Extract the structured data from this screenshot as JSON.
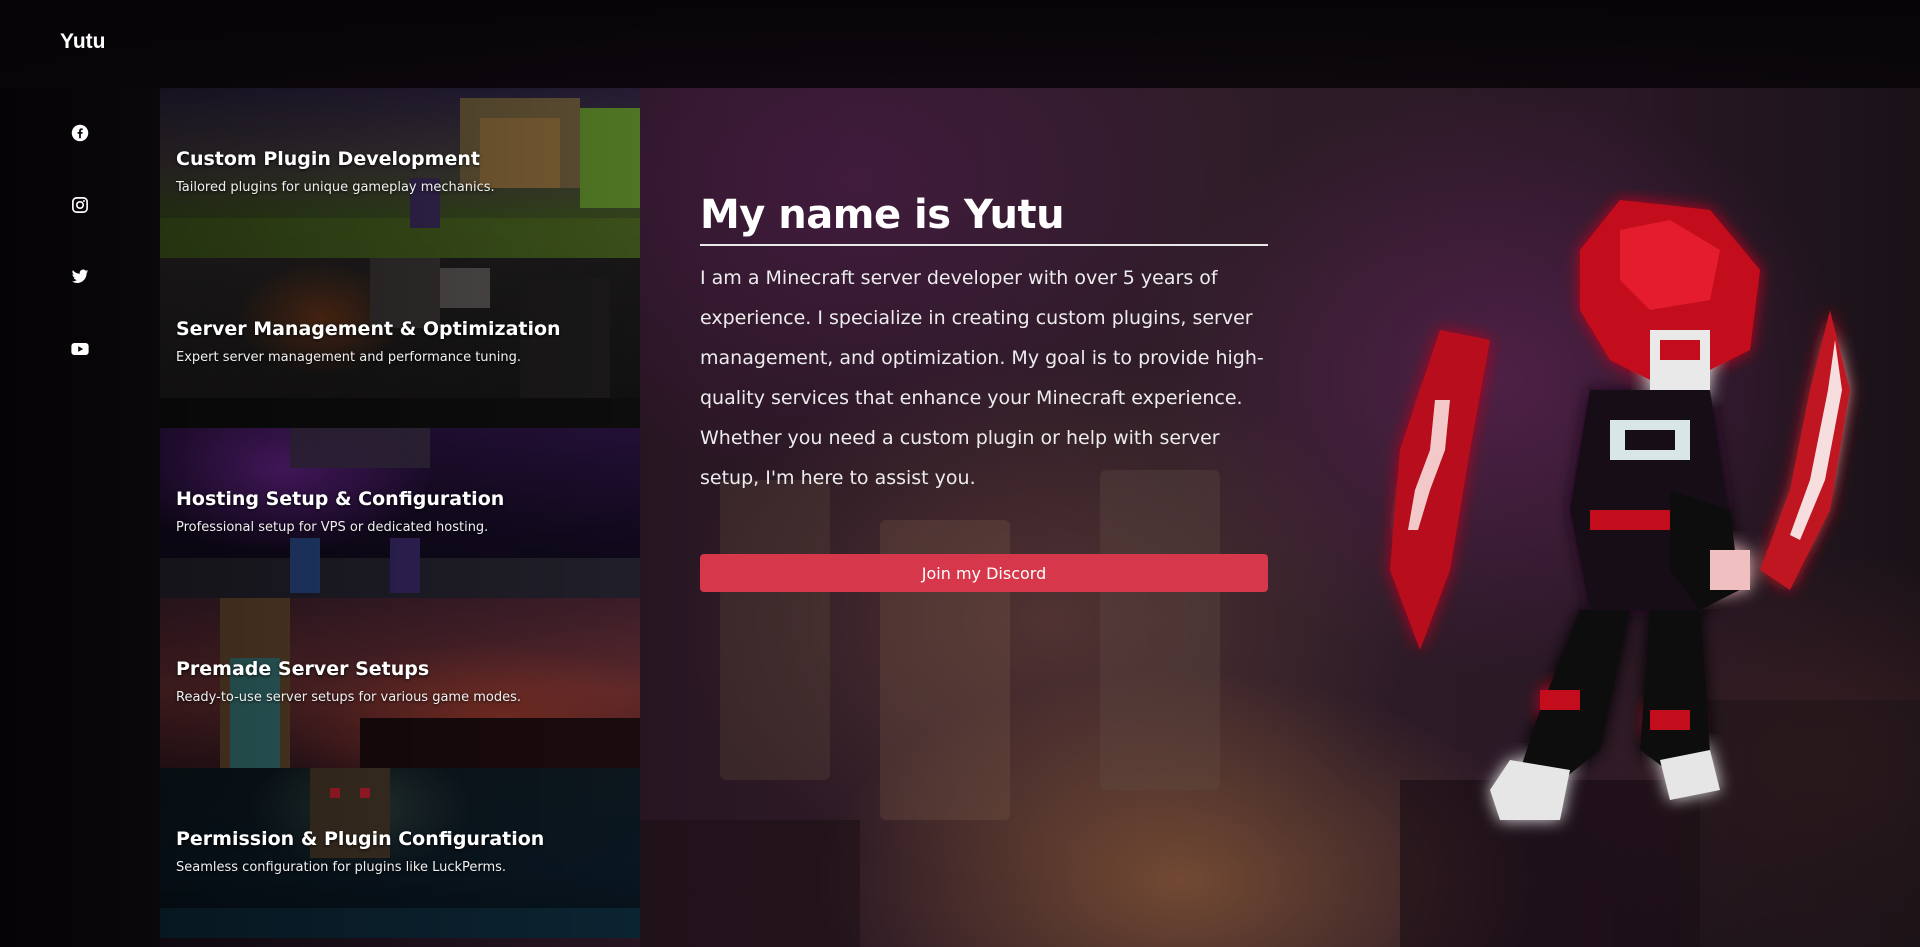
{
  "brand": {
    "name": "Yutu"
  },
  "social": [
    {
      "icon": "facebook-icon"
    },
    {
      "icon": "instagram-icon"
    },
    {
      "icon": "twitter-icon"
    },
    {
      "icon": "youtube-icon"
    }
  ],
  "services": [
    {
      "title": "Custom Plugin Development",
      "desc": "Tailored plugins for unique gameplay mechanics."
    },
    {
      "title": "Server Management & Optimization",
      "desc": "Expert server management and performance tuning."
    },
    {
      "title": "Hosting Setup & Configuration",
      "desc": "Professional setup for VPS or dedicated hosting."
    },
    {
      "title": "Premade Server Setups",
      "desc": "Ready-to-use server setups for various game modes."
    },
    {
      "title": "Permission & Plugin Configuration",
      "desc": "Seamless configuration for plugins like LuckPerms."
    }
  ],
  "intro": {
    "heading": "My name is Yutu",
    "body": "I am a Minecraft server developer with over 5 years of experience. I specialize in creating custom plugins, server management, and optimization. My goal is to provide high-quality services that enhance your Minecraft experience. Whether you need a custom plugin or help with server setup, I'm here to assist you.",
    "cta_label": "Join my Discord"
  },
  "colors": {
    "accent": "#d7374a",
    "background": "#0a070b"
  }
}
